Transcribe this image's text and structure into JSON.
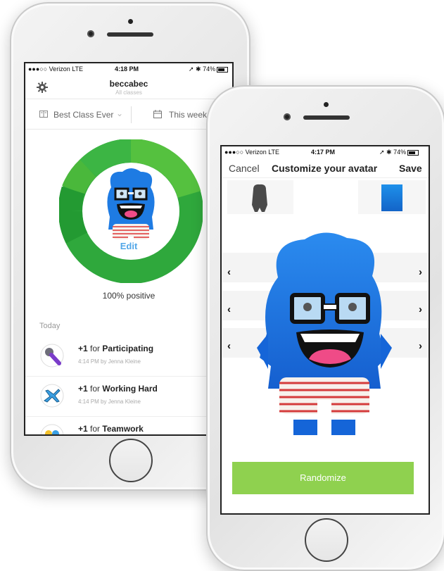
{
  "back_phone": {
    "status": {
      "carrier": "●●●○○ Verizon  LTE",
      "time": "4:18 PM",
      "battery": "➚ ✱ 74%"
    },
    "header": {
      "title": "beccabec",
      "subtitle": "All classes"
    },
    "filters": {
      "class_label": "Best Class Ever",
      "period_label": "This week"
    },
    "avatar": {
      "edit_label": "Edit"
    },
    "summary": {
      "positive_label": "100% positive",
      "positive_percent": 100
    },
    "feed": {
      "section_label": "Today",
      "items": [
        {
          "points": "+1",
          "connector": "for",
          "skill": "Participating",
          "meta": "4:14 PM by Jenna Kleine",
          "icon": "microphone-icon"
        },
        {
          "points": "+1",
          "connector": "for",
          "skill": "Working Hard",
          "meta": "4:14 PM by Jenna Kleine",
          "icon": "airplane-icon"
        },
        {
          "points": "+1",
          "connector": "for",
          "skill": "Teamwork",
          "meta": "",
          "icon": "teamwork-icon"
        }
      ]
    },
    "colors": {
      "ring_dark": "#2ea43c",
      "ring_light": "#58c142",
      "avatar_blue": "#1e7be3"
    }
  },
  "front_phone": {
    "status": {
      "carrier": "●●●○○ Verizon  LTE",
      "time": "4:17 PM",
      "battery": "➚ ✱ 74%"
    },
    "nav": {
      "cancel_label": "Cancel",
      "title": "Customize your avatar",
      "save_label": "Save"
    },
    "randomize_label": "Randomize",
    "colors": {
      "accent_green": "#8fd14f",
      "avatar_blue": "#1e7be3"
    }
  }
}
